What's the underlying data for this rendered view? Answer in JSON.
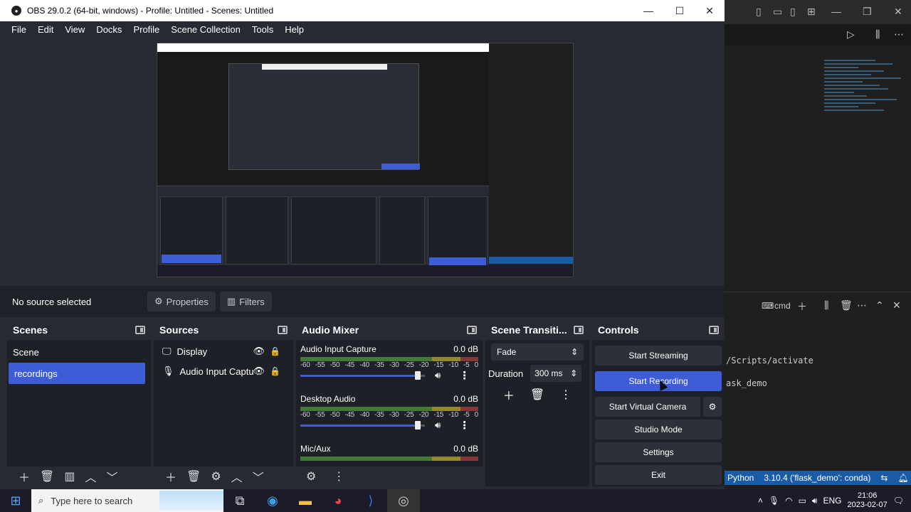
{
  "window": {
    "title": "OBS 29.0.2 (64-bit, windows) - Profile: Untitled - Scenes: Untitled",
    "minimize_glyph": "—",
    "maximize_glyph": "☐",
    "close_glyph": "✕"
  },
  "menu": [
    "File",
    "Edit",
    "View",
    "Docks",
    "Profile",
    "Scene Collection",
    "Tools",
    "Help"
  ],
  "source_bar": {
    "no_source": "No source selected",
    "properties": "Properties",
    "filters": "Filters"
  },
  "scenes": {
    "title": "Scenes",
    "items": [
      {
        "label": "Scene",
        "selected": false
      },
      {
        "label": "recordings",
        "selected": true
      }
    ]
  },
  "sources": {
    "title": "Sources",
    "items": [
      {
        "label": "Display",
        "icon": "monitor-icon"
      },
      {
        "label": "Audio Input Captu",
        "icon": "microphone-icon"
      }
    ]
  },
  "mixer": {
    "title": "Audio Mixer",
    "scale": [
      "-60",
      "-55",
      "-50",
      "-45",
      "-40",
      "-35",
      "-30",
      "-25",
      "-20",
      "-15",
      "-10",
      "-5",
      "0"
    ],
    "channels": [
      {
        "name": "Audio Input Capture",
        "db": "0.0 dB"
      },
      {
        "name": "Desktop Audio",
        "db": "0.0 dB"
      },
      {
        "name": "Mic/Aux",
        "db": "0.0 dB"
      }
    ]
  },
  "transitions": {
    "title": "Scene Transiti...",
    "selected": "Fade",
    "duration_label": "Duration",
    "duration_value": "300 ms"
  },
  "controls": {
    "title": "Controls",
    "start_streaming": "Start Streaming",
    "start_recording": "Start Recording",
    "start_virtual_camera": "Start Virtual Camera",
    "studio_mode": "Studio Mode",
    "settings": "Settings",
    "exit": "Exit"
  },
  "terminal": {
    "tab": "cmd",
    "line1": "/Scripts/activate",
    "line2": "ask_demo"
  },
  "statusbar": {
    "lang": "Python",
    "env": "3.10.4 ('flask_demo': conda)"
  },
  "taskbar": {
    "search_placeholder": "Type here to search",
    "lang": "ENG",
    "time": "21:06",
    "date": "2023-02-07"
  },
  "colors": {
    "accent": "#3e5cd6",
    "panel": "#1e2028",
    "background": "#272a33",
    "vscode_status": "#1a5ba6"
  }
}
